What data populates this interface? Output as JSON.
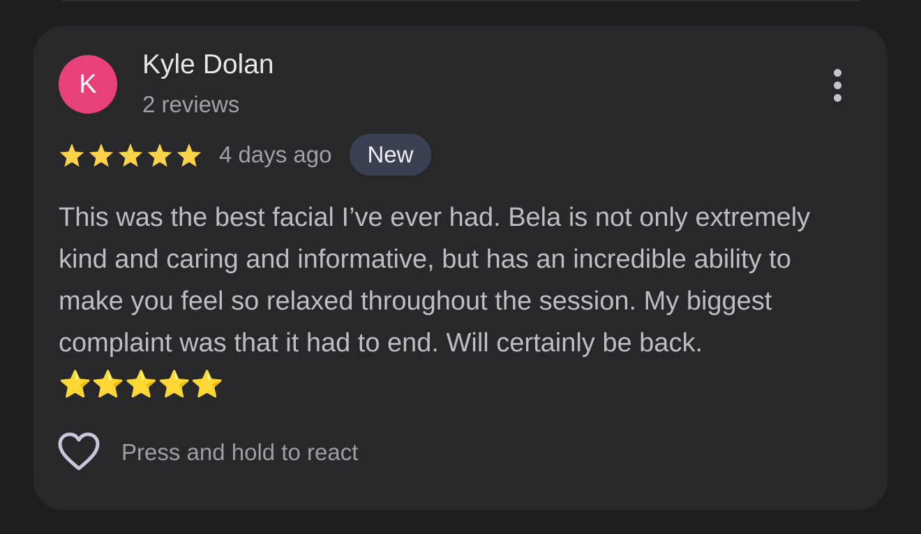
{
  "review": {
    "author": {
      "initial": "K",
      "avatar_color": "#e8417a",
      "name": "Kyle Dolan",
      "review_count": "2 reviews"
    },
    "rating": 5,
    "rating_max": 5,
    "star_color": "#fbd248",
    "time_ago": "4 days ago",
    "badge": "New",
    "text": "This was the best facial I’ve ever had. Bela is not only extremely kind and caring and informative, but has an incredible ability to make you feel so relaxed throughout the session. My biggest complaint was that it had to end. Will certainly be back. ⭐️⭐️⭐️⭐️⭐️",
    "react_prompt": "Press and hold to react",
    "icons": {
      "menu": "more-vertical-icon",
      "react": "heart-icon"
    }
  }
}
